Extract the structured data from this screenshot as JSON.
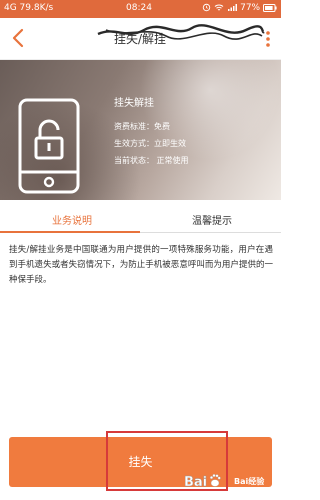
{
  "status_bar": {
    "left": "4G 79.8K/s",
    "time": "08:24",
    "right": "77%"
  },
  "header": {
    "title": "挂失/解挂"
  },
  "hero": {
    "service_name": "挂失解挂",
    "fee_label": "资费标准：免费",
    "effect_label": "生效方式：立即生效",
    "status_label": "当前状态：  正常使用"
  },
  "tabs": [
    {
      "label": "业务说明",
      "active": true
    },
    {
      "label": "温馨提示",
      "active": false
    }
  ],
  "description": "挂失/解挂业务是中国联通为用户提供的一项特殊服务功能，用户在遇到手机遗失或者失窃情况下，为防止手机被恶意呼叫而为用户提供的一种保手段。",
  "bottom_button": {
    "label": "挂失"
  },
  "watermark": {
    "text": "Bai经验"
  },
  "colors": {
    "accent": "#e8733c",
    "button": "#f07b3e",
    "status_bar": "#e06a3c",
    "highlight": "#d63a3a"
  }
}
